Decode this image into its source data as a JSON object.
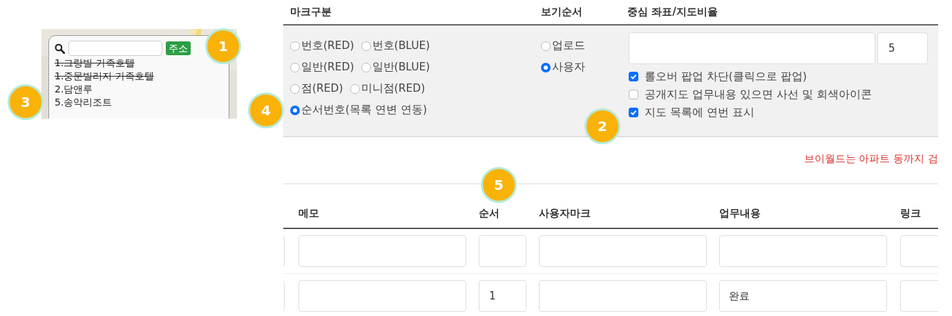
{
  "map_panel": {
    "address_button": "주소",
    "places": [
      {
        "label": "1.그랑빌 가족호텔",
        "struck": true
      },
      {
        "label": "1.중문빌리지 가족호텔",
        "struck": true
      },
      {
        "label": "2.담앤루",
        "struck": false
      },
      {
        "label": "5.송악리조트",
        "struck": false
      }
    ]
  },
  "options": {
    "headers": [
      "마크구분",
      "보기순서",
      "중심 좌표/지도비율"
    ],
    "mark_type_rows": [
      [
        {
          "label": "번호(RED)",
          "selected": false
        },
        {
          "label": "번호(BLUE)",
          "selected": false
        }
      ],
      [
        {
          "label": "일반(RED)",
          "selected": false
        },
        {
          "label": "일반(BLUE)",
          "selected": false
        }
      ],
      [
        {
          "label": "점(RED)",
          "selected": false
        },
        {
          "label": "미니점(RED)",
          "selected": false
        }
      ],
      [
        {
          "label": "순서번호(목록 연변 연동)",
          "selected": true
        }
      ]
    ],
    "view_order": [
      {
        "label": "업로드",
        "selected": false
      },
      {
        "label": "사용자",
        "selected": true
      }
    ],
    "zoom_value": "5",
    "checkboxes": [
      {
        "label": "롤오버 팝업 차단(클릭으로 팝업)",
        "checked": true
      },
      {
        "label": "공개지도 업무내용 있으면 사선 및 회색아이콘",
        "checked": false
      },
      {
        "label": "지도 목록에 연번 표시",
        "checked": true
      }
    ]
  },
  "notice": "브이월드는 아파트 동까지 검",
  "table": {
    "columns": [
      "메모",
      "순서",
      "사용자마크",
      "업무내용",
      "링크"
    ],
    "rows": [
      {},
      {
        "order": "1",
        "task": "완료"
      }
    ]
  },
  "callouts": [
    {
      "label": "1"
    },
    {
      "label": "2"
    },
    {
      "label": "3"
    },
    {
      "label": "4"
    },
    {
      "label": "5"
    }
  ]
}
